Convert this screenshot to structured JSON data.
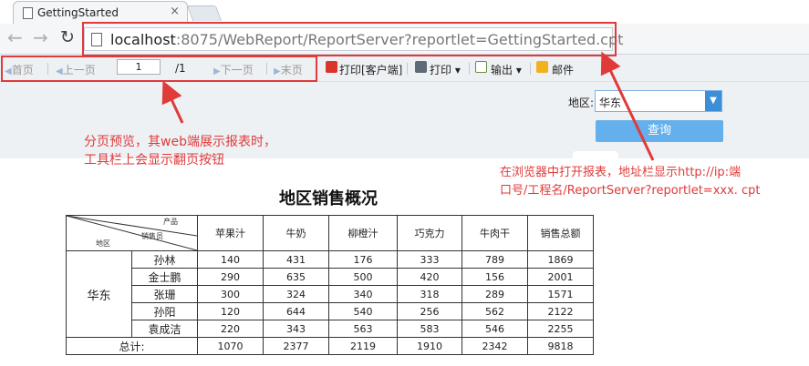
{
  "browser": {
    "tab_title": "GettingStarted",
    "tab_close": "×",
    "url_host": "localhost",
    "url_rest": ":8075/WebReport/ReportServer?reportlet=GettingStarted.cpt"
  },
  "toolbar": {
    "first": "首页",
    "prev": "上一页",
    "page_value": "1",
    "page_total": "/1",
    "next": "下一页",
    "last": "末页",
    "print_client": "打印[客户端]",
    "print": "打印",
    "export": "输出",
    "mail": "邮件"
  },
  "params": {
    "region_label": "地区:",
    "region_value": "华东",
    "query_button": "查询"
  },
  "report": {
    "title": "地区销售概况",
    "header_product": "产品",
    "header_salesperson": "销售员",
    "header_region": "地区",
    "columns": [
      "苹果汁",
      "牛奶",
      "柳橙汁",
      "巧克力",
      "牛肉干",
      "销售总额"
    ],
    "region": "华东",
    "rows": [
      {
        "name": "孙林",
        "values": [
          "140",
          "431",
          "176",
          "333",
          "789",
          "1869"
        ]
      },
      {
        "name": "金士鹏",
        "values": [
          "290",
          "635",
          "500",
          "420",
          "156",
          "2001"
        ]
      },
      {
        "name": "张珊",
        "values": [
          "300",
          "324",
          "340",
          "318",
          "289",
          "1571"
        ]
      },
      {
        "name": "孙阳",
        "values": [
          "120",
          "644",
          "540",
          "256",
          "562",
          "2122"
        ]
      },
      {
        "name": "袁成洁",
        "values": [
          "220",
          "343",
          "563",
          "583",
          "546",
          "2255"
        ]
      }
    ],
    "total_label": "总计:",
    "totals": [
      "1070",
      "2377",
      "2119",
      "1910",
      "2342",
      "9818"
    ]
  },
  "annotations": {
    "left_line1": "分页预览，其web端展示报表时，",
    "left_line2": "工具栏上会显示翻页按钮",
    "right_line1": "在浏览器中打开报表，地址栏显示http://ip:端",
    "right_line2": "口号/工程名/ReportServer?reportlet=xxx. cpt"
  },
  "colors": {
    "annotation_red": "#e03a3a",
    "query_button": "#63b0ec",
    "toolbar_bg": "#eef1f4"
  }
}
